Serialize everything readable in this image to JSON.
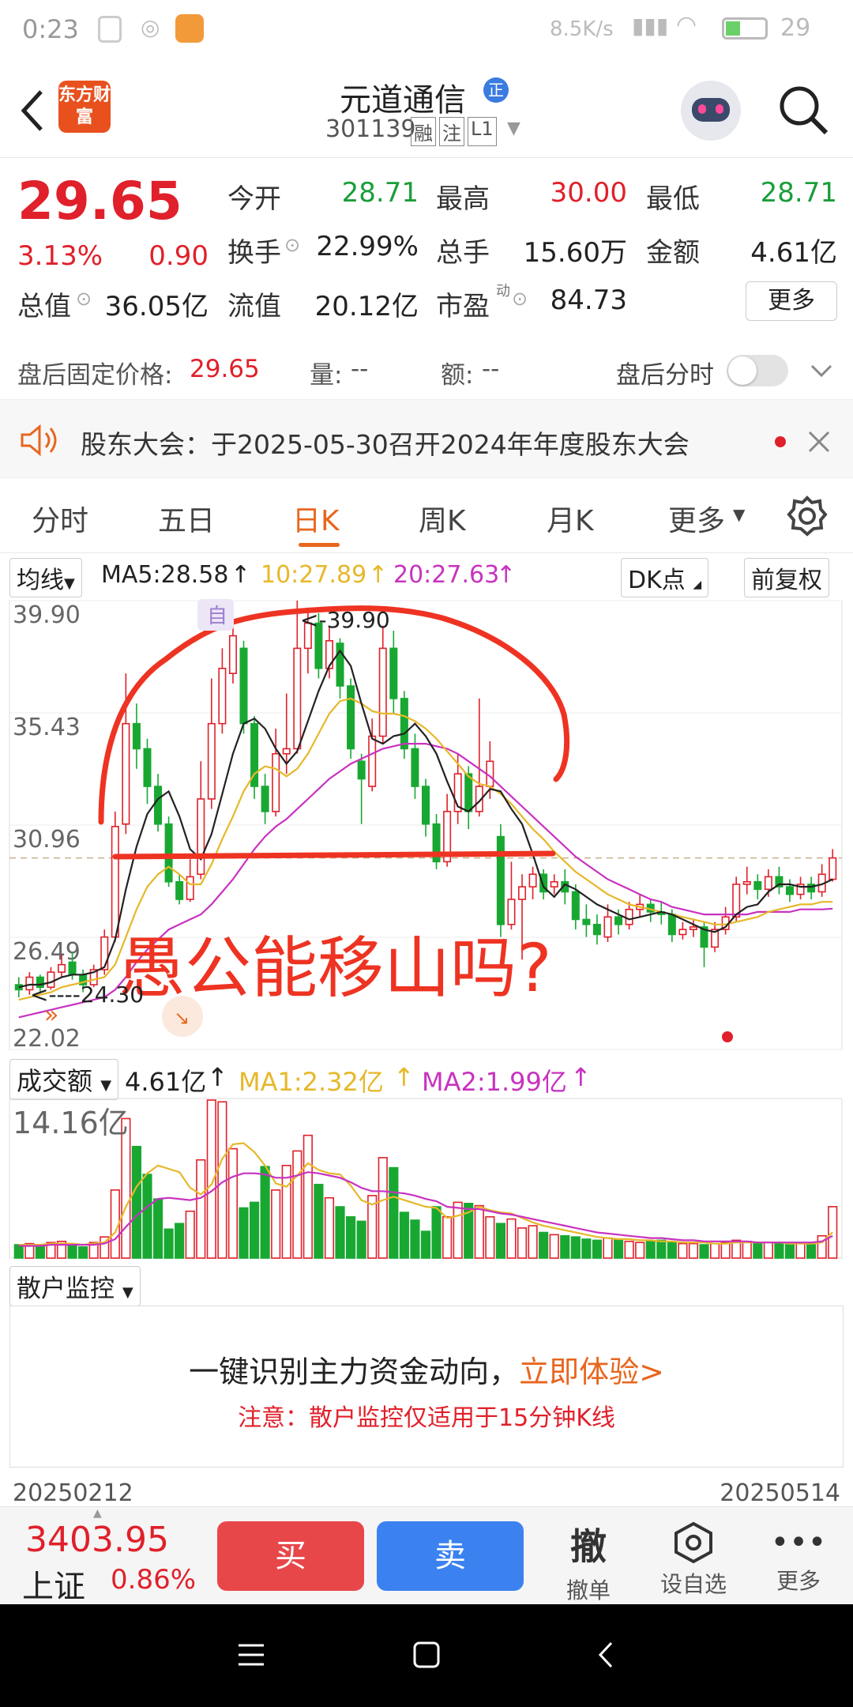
{
  "status_bar": {
    "time": "0:23",
    "network_speed": "8.5K/s",
    "battery": "29"
  },
  "header": {
    "app_logo": "东方财富",
    "title": "元道通信",
    "title_badge": "正",
    "code": "301139",
    "tags": [
      "融",
      "注",
      "L1"
    ]
  },
  "quote": {
    "price": "29.65",
    "change_pct": "3.13%",
    "change": "0.90",
    "row1": [
      {
        "label": "今开",
        "value": "28.71",
        "color": "green"
      },
      {
        "label": "最高",
        "value": "30.00",
        "color": "red"
      },
      {
        "label": "最低",
        "value": "28.71",
        "color": "green"
      }
    ],
    "row2": [
      {
        "label": "换手",
        "value": "22.99%"
      },
      {
        "label": "总手",
        "value": "15.60万"
      },
      {
        "label": "金额",
        "value": "4.61亿"
      }
    ],
    "row3": [
      {
        "label": "总值",
        "value": "36.05亿"
      },
      {
        "label": "流值",
        "value": "20.12亿"
      },
      {
        "label": "市盈",
        "label_sup": "动",
        "value": "84.73"
      }
    ],
    "more_label": "更多"
  },
  "after_hours": {
    "label": "盘后固定价格:",
    "price": "29.65",
    "vol_label": "量:",
    "vol_value": "--",
    "amt_label": "额:",
    "amt_value": "--",
    "toggle_label": "盘后分时"
  },
  "notice": {
    "text": "股东大会：于2025-05-30召开2024年年度股东大会"
  },
  "tabs": [
    {
      "label": "分时",
      "active": false
    },
    {
      "label": "五日",
      "active": false
    },
    {
      "label": "日K",
      "active": true
    },
    {
      "label": "周K",
      "active": false
    },
    {
      "label": "月K",
      "active": false
    },
    {
      "label": "更多",
      "active": false
    }
  ],
  "ma_bar": {
    "selector": "均线",
    "ma5": "MA5:28.58",
    "ma10": "10:27.89",
    "ma20": "20:27.63",
    "dk": "DK点",
    "adjust": "前复权",
    "arrow": "↑"
  },
  "chart_data": {
    "type": "candlestick",
    "y_ticks": [
      "39.90",
      "35.43",
      "30.96",
      "26.49",
      "22.02"
    ],
    "ylim": [
      22.02,
      39.9
    ],
    "high_marker": "<-39.90",
    "low_marker": "<----24.30",
    "self_marker": "自",
    "annotation": "愚公能移山吗?",
    "last_close": 29.65,
    "candles": [
      [
        24.6,
        24.4,
        24.9,
        24.1
      ],
      [
        24.4,
        24.9,
        25.1,
        24.2
      ],
      [
        24.9,
        24.5,
        25.0,
        24.3
      ],
      [
        24.5,
        25.1,
        25.3,
        24.4
      ],
      [
        25.1,
        25.4,
        25.8,
        24.9
      ],
      [
        25.5,
        25.0,
        25.9,
        24.8
      ],
      [
        25.0,
        24.6,
        25.2,
        24.3
      ],
      [
        24.6,
        25.2,
        25.4,
        24.5
      ],
      [
        25.2,
        26.5,
        26.8,
        25.0
      ],
      [
        26.5,
        30.9,
        31.5,
        26.3
      ],
      [
        31.0,
        35.0,
        37.0,
        30.6
      ],
      [
        35.0,
        34.0,
        35.8,
        33.2
      ],
      [
        34.0,
        32.5,
        34.4,
        31.8
      ],
      [
        32.5,
        31.0,
        33.0,
        30.7
      ],
      [
        31.0,
        28.7,
        31.3,
        28.5
      ],
      [
        28.7,
        28.0,
        29.0,
        27.8
      ],
      [
        28.0,
        28.9,
        29.6,
        27.9
      ],
      [
        29.0,
        32.0,
        33.5,
        28.8
      ],
      [
        32.0,
        35.0,
        36.8,
        31.6
      ],
      [
        35.0,
        37.2,
        38.0,
        34.6
      ],
      [
        37.0,
        38.5,
        38.9,
        36.6
      ],
      [
        38.0,
        35.0,
        38.3,
        34.6
      ],
      [
        35.0,
        32.5,
        35.3,
        32.0
      ],
      [
        32.5,
        31.5,
        33.0,
        31.0
      ],
      [
        31.5,
        33.8,
        34.8,
        31.3
      ],
      [
        33.8,
        34.0,
        36.2,
        33.0
      ],
      [
        34.0,
        38.0,
        39.9,
        33.8
      ],
      [
        38.0,
        39.0,
        39.5,
        37.0
      ],
      [
        39.0,
        37.2,
        39.4,
        36.8
      ],
      [
        37.2,
        38.3,
        38.9,
        36.8
      ],
      [
        38.2,
        36.5,
        38.4,
        36.0
      ],
      [
        36.5,
        34.0,
        36.8,
        33.6
      ],
      [
        33.5,
        32.8,
        33.8,
        31.0
      ],
      [
        32.5,
        34.5,
        35.2,
        32.3
      ],
      [
        34.5,
        38.0,
        38.9,
        34.2
      ],
      [
        38.0,
        36.0,
        38.7,
        35.4
      ],
      [
        36.0,
        34.0,
        36.3,
        33.6
      ],
      [
        34.0,
        32.5,
        34.6,
        32.0
      ],
      [
        32.5,
        31.0,
        32.8,
        30.5
      ],
      [
        31.0,
        29.5,
        31.4,
        29.2
      ],
      [
        29.5,
        31.5,
        32.2,
        29.3
      ],
      [
        31.5,
        33.0,
        33.8,
        31.0
      ],
      [
        33.0,
        31.5,
        33.3,
        30.8
      ],
      [
        31.5,
        32.5,
        36.0,
        31.3
      ],
      [
        32.5,
        33.5,
        34.3,
        32.0
      ],
      [
        30.5,
        27.0,
        31.0,
        26.5
      ],
      [
        27.0,
        28.0,
        29.5,
        26.8
      ],
      [
        28.0,
        28.5,
        29.0,
        25.6
      ],
      [
        28.5,
        29.0,
        29.3,
        28.0
      ],
      [
        29.0,
        28.3,
        29.2,
        28.0
      ],
      [
        28.5,
        28.7,
        29.0,
        28.2
      ],
      [
        28.7,
        28.3,
        29.2,
        27.8
      ],
      [
        28.3,
        27.2,
        28.6,
        26.8
      ],
      [
        27.2,
        27.0,
        27.8,
        26.5
      ],
      [
        27.0,
        26.6,
        27.4,
        26.2
      ],
      [
        26.5,
        27.3,
        27.8,
        26.3
      ],
      [
        27.3,
        27.0,
        27.6,
        26.6
      ],
      [
        27.0,
        27.6,
        27.9,
        26.8
      ],
      [
        27.6,
        27.8,
        28.2,
        27.3
      ],
      [
        27.8,
        27.5,
        28.0,
        27.1
      ],
      [
        27.5,
        27.4,
        27.9,
        27.0
      ],
      [
        27.4,
        26.6,
        27.6,
        26.3
      ],
      [
        26.6,
        26.8,
        27.1,
        26.4
      ],
      [
        26.8,
        26.9,
        27.2,
        26.5
      ],
      [
        26.9,
        26.1,
        27.1,
        25.3
      ],
      [
        26.1,
        26.8,
        27.1,
        25.9
      ],
      [
        26.8,
        27.3,
        27.7,
        26.6
      ],
      [
        27.3,
        28.6,
        28.9,
        27.1
      ],
      [
        28.6,
        28.7,
        29.3,
        28.2
      ],
      [
        28.7,
        28.4,
        29.0,
        28.0
      ],
      [
        28.4,
        28.9,
        29.2,
        28.1
      ],
      [
        28.9,
        28.5,
        29.3,
        28.2
      ],
      [
        28.5,
        28.2,
        28.8,
        27.9
      ],
      [
        28.2,
        28.6,
        28.9,
        28.0
      ],
      [
        28.6,
        28.3,
        28.9,
        28.0
      ],
      [
        28.3,
        29.0,
        29.4,
        28.1
      ],
      [
        28.8,
        29.65,
        30.0,
        28.71
      ]
    ],
    "ma5": [
      24.5,
      24.6,
      24.6,
      24.7,
      24.9,
      25.0,
      25.0,
      25.1,
      25.3,
      26.4,
      28.4,
      30.1,
      31.4,
      32.0,
      32.3,
      31.3,
      30.0,
      29.6,
      30.6,
      32.2,
      33.8,
      35.0,
      35.2,
      34.8,
      34.0,
      33.4,
      33.9,
      35.1,
      36.3,
      37.3,
      37.9,
      37.3,
      35.8,
      34.4,
      34.2,
      34.5,
      34.6,
      35.0,
      34.5,
      33.8,
      32.7,
      31.7,
      31.5,
      31.9,
      32.4,
      32.3,
      31.6,
      31.0,
      29.8,
      28.5,
      28.1,
      28.6,
      28.4,
      28.1,
      27.8,
      27.6,
      27.4,
      27.2,
      27.3,
      27.4,
      27.5,
      27.4,
      27.2,
      27.0,
      26.8,
      26.7,
      26.9,
      27.4,
      27.7,
      27.8,
      28.3,
      28.6,
      28.6,
      28.5,
      28.5,
      28.6,
      28.8
    ],
    "ma10": [
      24.0,
      24.1,
      24.2,
      24.3,
      24.5,
      24.6,
      24.7,
      24.8,
      24.9,
      25.4,
      26.5,
      27.6,
      28.5,
      29.0,
      29.3,
      29.0,
      28.6,
      28.6,
      29.4,
      30.4,
      31.3,
      32.3,
      33.0,
      33.3,
      33.2,
      32.9,
      33.2,
      33.8,
      34.6,
      35.4,
      35.9,
      36.0,
      35.8,
      35.5,
      35.4,
      35.4,
      35.3,
      35.1,
      34.8,
      34.4,
      33.9,
      33.4,
      32.9,
      32.6,
      32.5,
      32.2,
      31.8,
      31.3,
      30.8,
      30.4,
      29.9,
      29.5,
      29.1,
      28.8,
      28.5,
      28.2,
      28.0,
      27.8,
      27.7,
      27.6,
      27.5,
      27.4,
      27.3,
      27.2,
      27.1,
      27.0,
      27.0,
      27.1,
      27.2,
      27.3,
      27.5,
      27.6,
      27.7,
      27.8,
      27.8,
      27.9,
      27.9
    ],
    "ma20": [
      23.3,
      23.4,
      23.5,
      23.6,
      23.7,
      23.8,
      23.9,
      24.0,
      24.1,
      24.4,
      24.9,
      25.5,
      26.0,
      26.4,
      26.8,
      27.0,
      27.2,
      27.4,
      27.8,
      28.3,
      28.8,
      29.4,
      30.0,
      30.5,
      30.9,
      31.2,
      31.6,
      32.0,
      32.4,
      32.8,
      33.1,
      33.4,
      33.6,
      33.8,
      34.0,
      34.1,
      34.2,
      34.2,
      34.2,
      34.1,
      34.0,
      33.8,
      33.5,
      33.2,
      32.9,
      32.5,
      32.1,
      31.7,
      31.3,
      30.9,
      30.5,
      30.1,
      29.7,
      29.4,
      29.1,
      28.8,
      28.6,
      28.4,
      28.2,
      28.0,
      27.9,
      27.7,
      27.6,
      27.5,
      27.4,
      27.4,
      27.4,
      27.4,
      27.4,
      27.5,
      27.5,
      27.5,
      27.5,
      27.6,
      27.6,
      27.6,
      27.63
    ],
    "colors": {
      "up": "#e0202a",
      "down": "#18a832",
      "ma5": "#222222",
      "ma10": "#e6b82a",
      "ma20": "#c832c0",
      "annotation": "#ee3322"
    }
  },
  "volume": {
    "selector": "成交额",
    "value": "4.61亿",
    "ma1": "MA1:2.32亿",
    "ma2": "MA2:1.99亿",
    "arrow": "↑",
    "y_tick": "14.16亿",
    "max": 14.16,
    "values": [
      1.2,
      1.3,
      1.1,
      1.4,
      1.5,
      1.2,
      1.0,
      1.4,
      1.9,
      6.1,
      12.5,
      10.0,
      7.5,
      5.3,
      2.6,
      3.1,
      4.2,
      8.8,
      14.16,
      14.0,
      9.8,
      4.5,
      5.0,
      8.2,
      6.1,
      8.3,
      9.6,
      11.0,
      6.6,
      5.4,
      4.6,
      3.7,
      3.3,
      5.6,
      9.0,
      8.1,
      4.1,
      3.4,
      2.4,
      4.6,
      3.7,
      5.0,
      4.9,
      4.7,
      3.7,
      3.1,
      3.5,
      2.7,
      2.9,
      2.3,
      2.1,
      2.0,
      1.9,
      1.7,
      1.6,
      1.8,
      1.7,
      1.5,
      1.4,
      1.5,
      1.6,
      1.4,
      1.3,
      1.3,
      1.2,
      1.3,
      1.4,
      1.6,
      1.5,
      1.3,
      1.4,
      1.3,
      1.2,
      1.3,
      1.2,
      2.0,
      4.61
    ],
    "ma1_line": [
      1.2,
      1.2,
      1.2,
      1.3,
      1.3,
      1.3,
      1.2,
      1.3,
      1.4,
      2.3,
      4.6,
      6.4,
      7.6,
      8.3,
      8.0,
      7.7,
      6.3,
      5.7,
      6.6,
      8.9,
      10.2,
      10.3,
      9.5,
      8.3,
      6.7,
      6.4,
      7.4,
      8.5,
      7.9,
      7.6,
      7.5,
      6.5,
      5.2,
      4.8,
      5.2,
      5.5,
      5.2,
      4.9,
      4.6,
      4.5,
      3.6,
      3.8,
      4.1,
      4.6,
      4.3,
      4.1,
      4.0,
      3.6,
      3.2,
      2.9,
      2.7,
      2.5,
      2.3,
      2.1,
      1.9,
      1.8,
      1.7,
      1.7,
      1.6,
      1.6,
      1.5,
      1.5,
      1.4,
      1.4,
      1.4,
      1.3,
      1.3,
      1.4,
      1.4,
      1.4,
      1.4,
      1.4,
      1.3,
      1.3,
      1.3,
      1.4,
      2.32
    ],
    "ma2_line": [
      1.1,
      1.1,
      1.1,
      1.2,
      1.2,
      1.2,
      1.2,
      1.2,
      1.3,
      1.7,
      2.8,
      3.8,
      4.6,
      5.3,
      5.4,
      5.3,
      5.2,
      5.4,
      6.0,
      6.8,
      7.3,
      7.6,
      7.6,
      7.5,
      7.2,
      7.2,
      7.4,
      7.7,
      7.6,
      7.4,
      7.2,
      6.8,
      6.3,
      6.0,
      6.0,
      5.9,
      5.8,
      5.6,
      5.3,
      5.1,
      4.6,
      4.5,
      4.4,
      4.4,
      4.2,
      4.0,
      3.9,
      3.7,
      3.5,
      3.3,
      3.1,
      2.9,
      2.7,
      2.5,
      2.3,
      2.2,
      2.1,
      2.0,
      1.9,
      1.8,
      1.8,
      1.7,
      1.6,
      1.6,
      1.5,
      1.5,
      1.5,
      1.5,
      1.5,
      1.4,
      1.4,
      1.4,
      1.4,
      1.4,
      1.4,
      1.5,
      1.99
    ]
  },
  "monitor": {
    "selector": "散户监控",
    "main_text": "一键识别主力资金动向，",
    "link_text": "立即体验>",
    "note": "注意：散户监控仅适用于15分钟K线"
  },
  "dates": {
    "start": "20250212",
    "end": "20250514"
  },
  "bottom_bar": {
    "index_value": "3403.95",
    "index_name": "上证",
    "index_change": "0.86%",
    "buy": "买",
    "sell": "卖",
    "cancel_icon": "撤",
    "cancel_label": "撤单",
    "favorite_label": "设自选",
    "more_label": "更多"
  }
}
